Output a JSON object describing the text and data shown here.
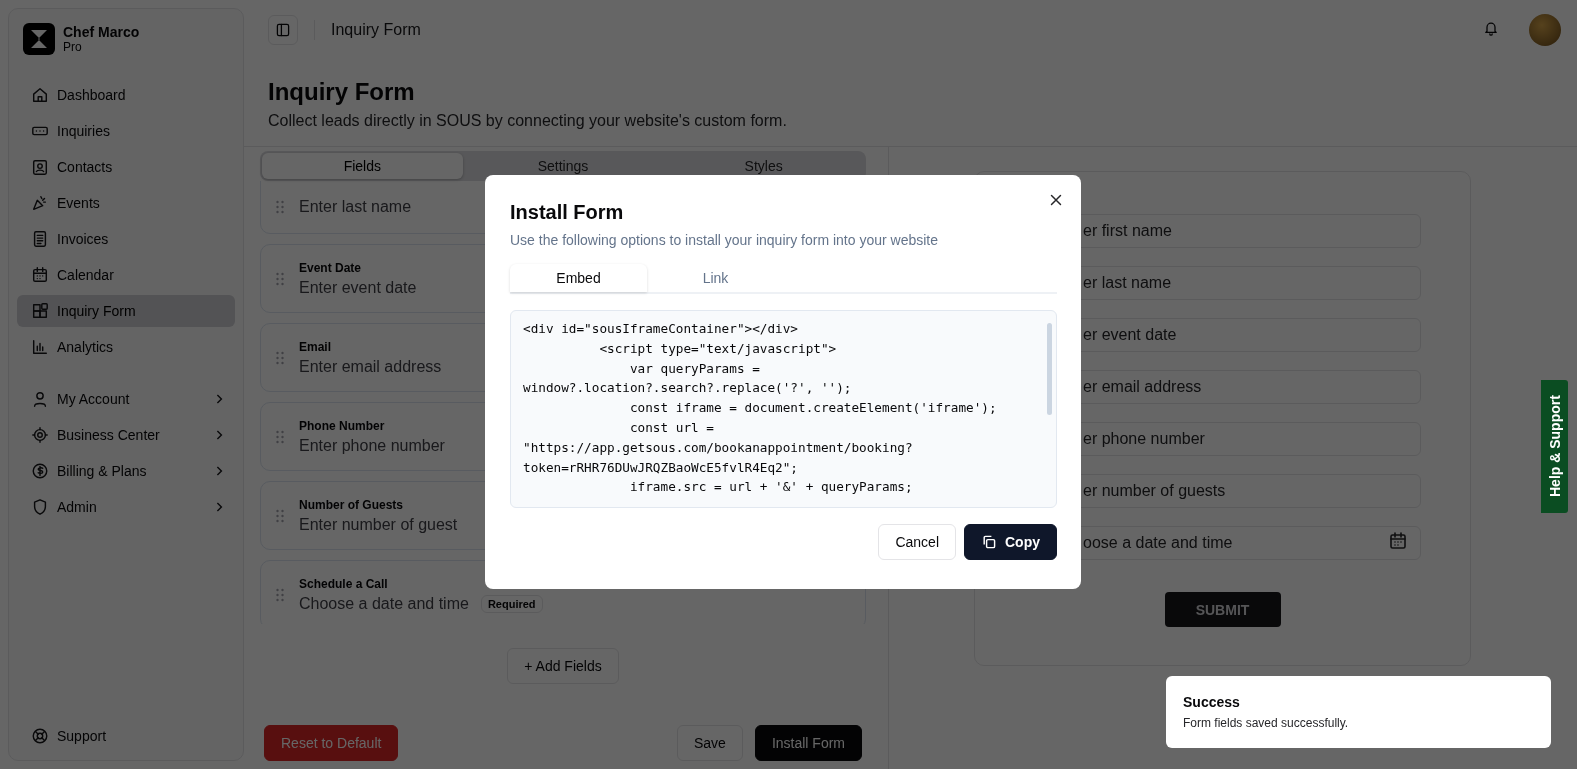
{
  "sidebar": {
    "user_name": "Chef Marco",
    "plan": "Pro",
    "items": [
      {
        "label": "Dashboard",
        "selected": false
      },
      {
        "label": "Inquiries",
        "selected": false
      },
      {
        "label": "Contacts",
        "selected": false
      },
      {
        "label": "Events",
        "selected": false
      },
      {
        "label": "Invoices",
        "selected": false
      },
      {
        "label": "Calendar",
        "selected": false
      },
      {
        "label": "Inquiry Form",
        "selected": true
      },
      {
        "label": "Analytics",
        "selected": false
      }
    ],
    "groups": [
      {
        "label": "My Account"
      },
      {
        "label": "Business Center"
      },
      {
        "label": "Billing & Plans"
      },
      {
        "label": "Admin"
      }
    ],
    "footer_item": "Support"
  },
  "header": {
    "breadcrumb": "Inquiry Form"
  },
  "page": {
    "title": "Inquiry Form",
    "subtitle": "Collect leads directly in SOUS by connecting your website's custom form."
  },
  "editor_tabs": [
    {
      "label": "Fields",
      "selected": true
    },
    {
      "label": "Settings",
      "selected": false
    },
    {
      "label": "Styles",
      "selected": false
    }
  ],
  "fields": [
    {
      "placeholder": "Enter last name"
    },
    {
      "label": "Event Date",
      "placeholder": "Enter event date"
    },
    {
      "label": "Email",
      "placeholder": "Enter email address"
    },
    {
      "label": "Phone Number",
      "placeholder": "Enter phone number"
    },
    {
      "label": "Number of Guests",
      "placeholder": "Enter number of guest"
    },
    {
      "label": "Schedule a Call",
      "placeholder": "Choose a date and time",
      "badge": "Required"
    }
  ],
  "add_fields_button": "+ Add Fields",
  "actions": {
    "reset": "Reset to Default",
    "save": "Save",
    "install": "Install Form"
  },
  "preview": {
    "fields": [
      {
        "kind": "text",
        "placeholder": "er first name"
      },
      {
        "kind": "text",
        "placeholder": "er last name"
      },
      {
        "kind": "text",
        "placeholder": "er event date"
      },
      {
        "kind": "text",
        "placeholder": "er email address"
      },
      {
        "kind": "text",
        "placeholder": "er phone number"
      },
      {
        "kind": "text",
        "placeholder": "er number of guests"
      },
      {
        "kind": "datetime",
        "placeholder": "oose a date and time"
      }
    ],
    "submit": "SUBMIT"
  },
  "help_tab": "Help & Support",
  "modal": {
    "title": "Install Form",
    "description": "Use the following options to install your inquiry form into your website",
    "tabs": [
      {
        "label": "Embed",
        "selected": true
      },
      {
        "label": "Link",
        "selected": false
      }
    ],
    "code": "<div id=\"sousIframeContainer\"></div>\n          <script type=\"text/javascript\">\n              var queryParams =\nwindow?.location?.search?.replace('?', '');\n              const iframe = document.createElement('iframe');\n              const url =\n\"https://app.getsous.com/bookanappointment/booking?\ntoken=rRHR76DUwJRQZBaoWcE5fvlR4Eq2\";\n              iframe.src = url + '&' + queryParams;",
    "cancel": "Cancel",
    "copy": "Copy"
  },
  "toast": {
    "title": "Success",
    "message": "Form fields saved successfully."
  }
}
